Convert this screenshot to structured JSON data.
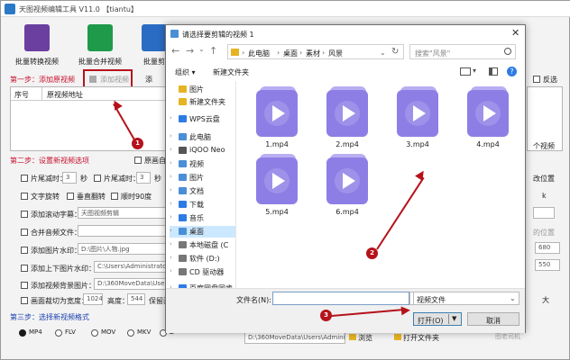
{
  "app": {
    "title": "天图视频编辑工具 V11.0 【tiantu】",
    "toolbar": [
      {
        "label": "批量转换视频",
        "color": "#6b3fa0"
      },
      {
        "label": "批量合并视频",
        "color": "#1f9a4a"
      },
      {
        "label": "批量剪",
        "color": "#2a6cc4"
      }
    ],
    "step1": "第一步：添加原视频",
    "add_video": "添加视频",
    "add_short": "添",
    "reverse": "反选",
    "grid_headers": [
      "序号",
      "原视频地址"
    ],
    "step2": "第二步：设置新视频选项",
    "step3": "第三步：选择新视频格式",
    "options": [
      {
        "label": "片尾减时：",
        "value": "3",
        "unit": "秒"
      },
      {
        "label": "片尾减时：",
        "value": "3",
        "unit": "秒"
      },
      {
        "label": "文字旋转"
      },
      {
        "label": "垂直翻转"
      },
      {
        "label": "顺时90度"
      },
      {
        "label": "添加滚动字幕：",
        "value": "天图视频剪辑"
      },
      {
        "label": "合并音频文件：",
        "value": ""
      },
      {
        "label": "添加图片水印：",
        "value": "D:\\图片\\人物.jpg"
      },
      {
        "label": "添加上下图片水印：",
        "value": "C:\\Users\\Administrator"
      },
      {
        "label": "添加视频背景图片：",
        "value": "D:\\360MoveData\\Users\\"
      },
      {
        "label": "画面裁切为宽度：",
        "value": "1024",
        "h_label": "高度：",
        "h_value": "544",
        "suffix": "保留画"
      }
    ],
    "original_size": "原画自",
    "formats": [
      "MP4",
      "FLV",
      "MOV",
      "MKV",
      "Z"
    ],
    "right_labels": [
      "个视频",
      "改位置",
      "k",
      "比率",
      "的位置",
      "680",
      "550",
      "大"
    ],
    "bottom_path": "D:\\360MoveData\\Users\\Administr",
    "browse": "浏览",
    "open_folder": "打开文件夹",
    "watermark": "图老司机"
  },
  "dialog": {
    "title": "请选择要剪辑的视频 1",
    "path": [
      "此电脑",
      "桌面",
      "素材",
      "风景"
    ],
    "search_placeholder": "搜索\"风景\"",
    "organize": "组织",
    "new_folder": "新建文件夹",
    "nav": [
      {
        "label": "图片",
        "icon": "folder-icon",
        "color": "#e6b422"
      },
      {
        "label": "新建文件夹",
        "icon": "folder-icon",
        "color": "#e6b422"
      },
      {
        "label": "WPS云盘",
        "icon": "cloud-icon",
        "color": "#2d7be5"
      },
      {
        "label": "此电脑",
        "icon": "computer-icon",
        "color": "#4a8fd6"
      },
      {
        "label": "iQOO Neo",
        "icon": "phone-icon",
        "color": "#555555"
      },
      {
        "label": "视频",
        "icon": "video-folder-icon",
        "color": "#4a8fd6"
      },
      {
        "label": "图片",
        "icon": "picture-folder-icon",
        "color": "#4a8fd6"
      },
      {
        "label": "文档",
        "icon": "document-folder-icon",
        "color": "#4a8fd6"
      },
      {
        "label": "下载",
        "icon": "download-icon",
        "color": "#2d7be5"
      },
      {
        "label": "音乐",
        "icon": "music-icon",
        "color": "#2d7be5"
      },
      {
        "label": "桌面",
        "icon": "desktop-icon",
        "color": "#4a8fd6"
      },
      {
        "label": "本地磁盘 (C",
        "icon": "drive-icon",
        "color": "#777777"
      },
      {
        "label": "软件 (D:)",
        "icon": "drive-icon",
        "color": "#777777"
      },
      {
        "label": "CD 驱动器",
        "icon": "cd-icon",
        "color": "#777777"
      },
      {
        "label": "百度网盘同步",
        "icon": "cloud-icon",
        "color": "#2d7be5"
      }
    ],
    "files": [
      "1.mp4",
      "2.mp4",
      "3.mp4",
      "4.mp4",
      "5.mp4",
      "6.mp4"
    ],
    "filename_label": "文件名(N):",
    "filename_value": "",
    "filetype": "视频文件",
    "open": "打开(O)",
    "cancel": "取消",
    "accent": "#8d7ee6"
  },
  "annotations": [
    "1",
    "2",
    "3"
  ]
}
